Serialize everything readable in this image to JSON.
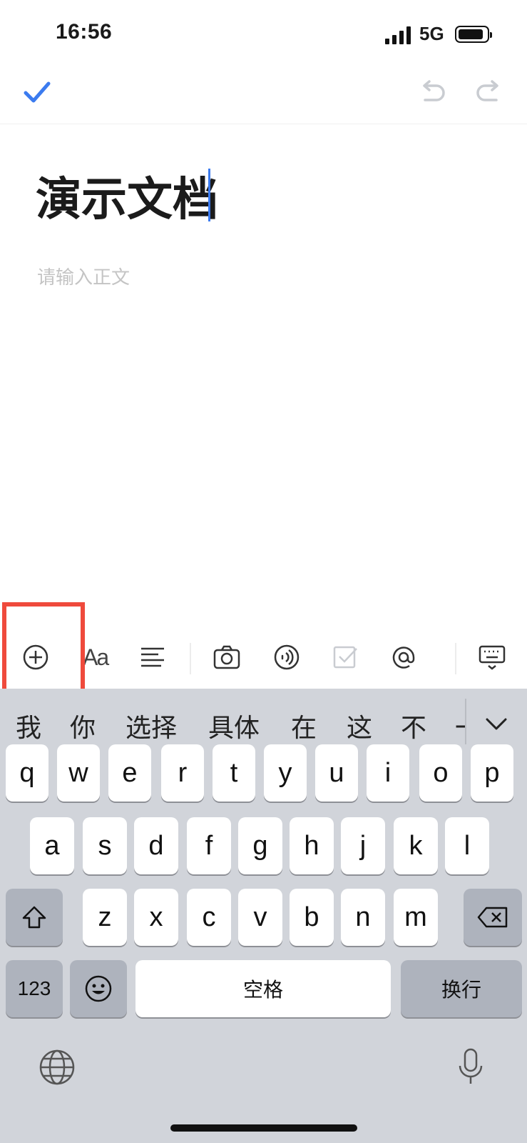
{
  "status_bar": {
    "time": "16:56",
    "network": "5G"
  },
  "document": {
    "title": "演示文档",
    "body_placeholder": "请输入正文"
  },
  "candidates": [
    "我",
    "你",
    "选择",
    "具体",
    "在",
    "这",
    "不",
    "一"
  ],
  "keyboard": {
    "row1": [
      "q",
      "w",
      "e",
      "r",
      "t",
      "y",
      "u",
      "i",
      "o",
      "p"
    ],
    "row2": [
      "a",
      "s",
      "d",
      "f",
      "g",
      "h",
      "j",
      "k",
      "l"
    ],
    "row3": [
      "z",
      "x",
      "c",
      "v",
      "b",
      "n",
      "m"
    ],
    "numbers_label": "123",
    "space_label": "空格",
    "return_label": "换行"
  },
  "toolbar": {
    "font_icon_label": "Aa"
  },
  "colors": {
    "accent": "#3b7bef",
    "highlight": "#ef4a3c"
  }
}
